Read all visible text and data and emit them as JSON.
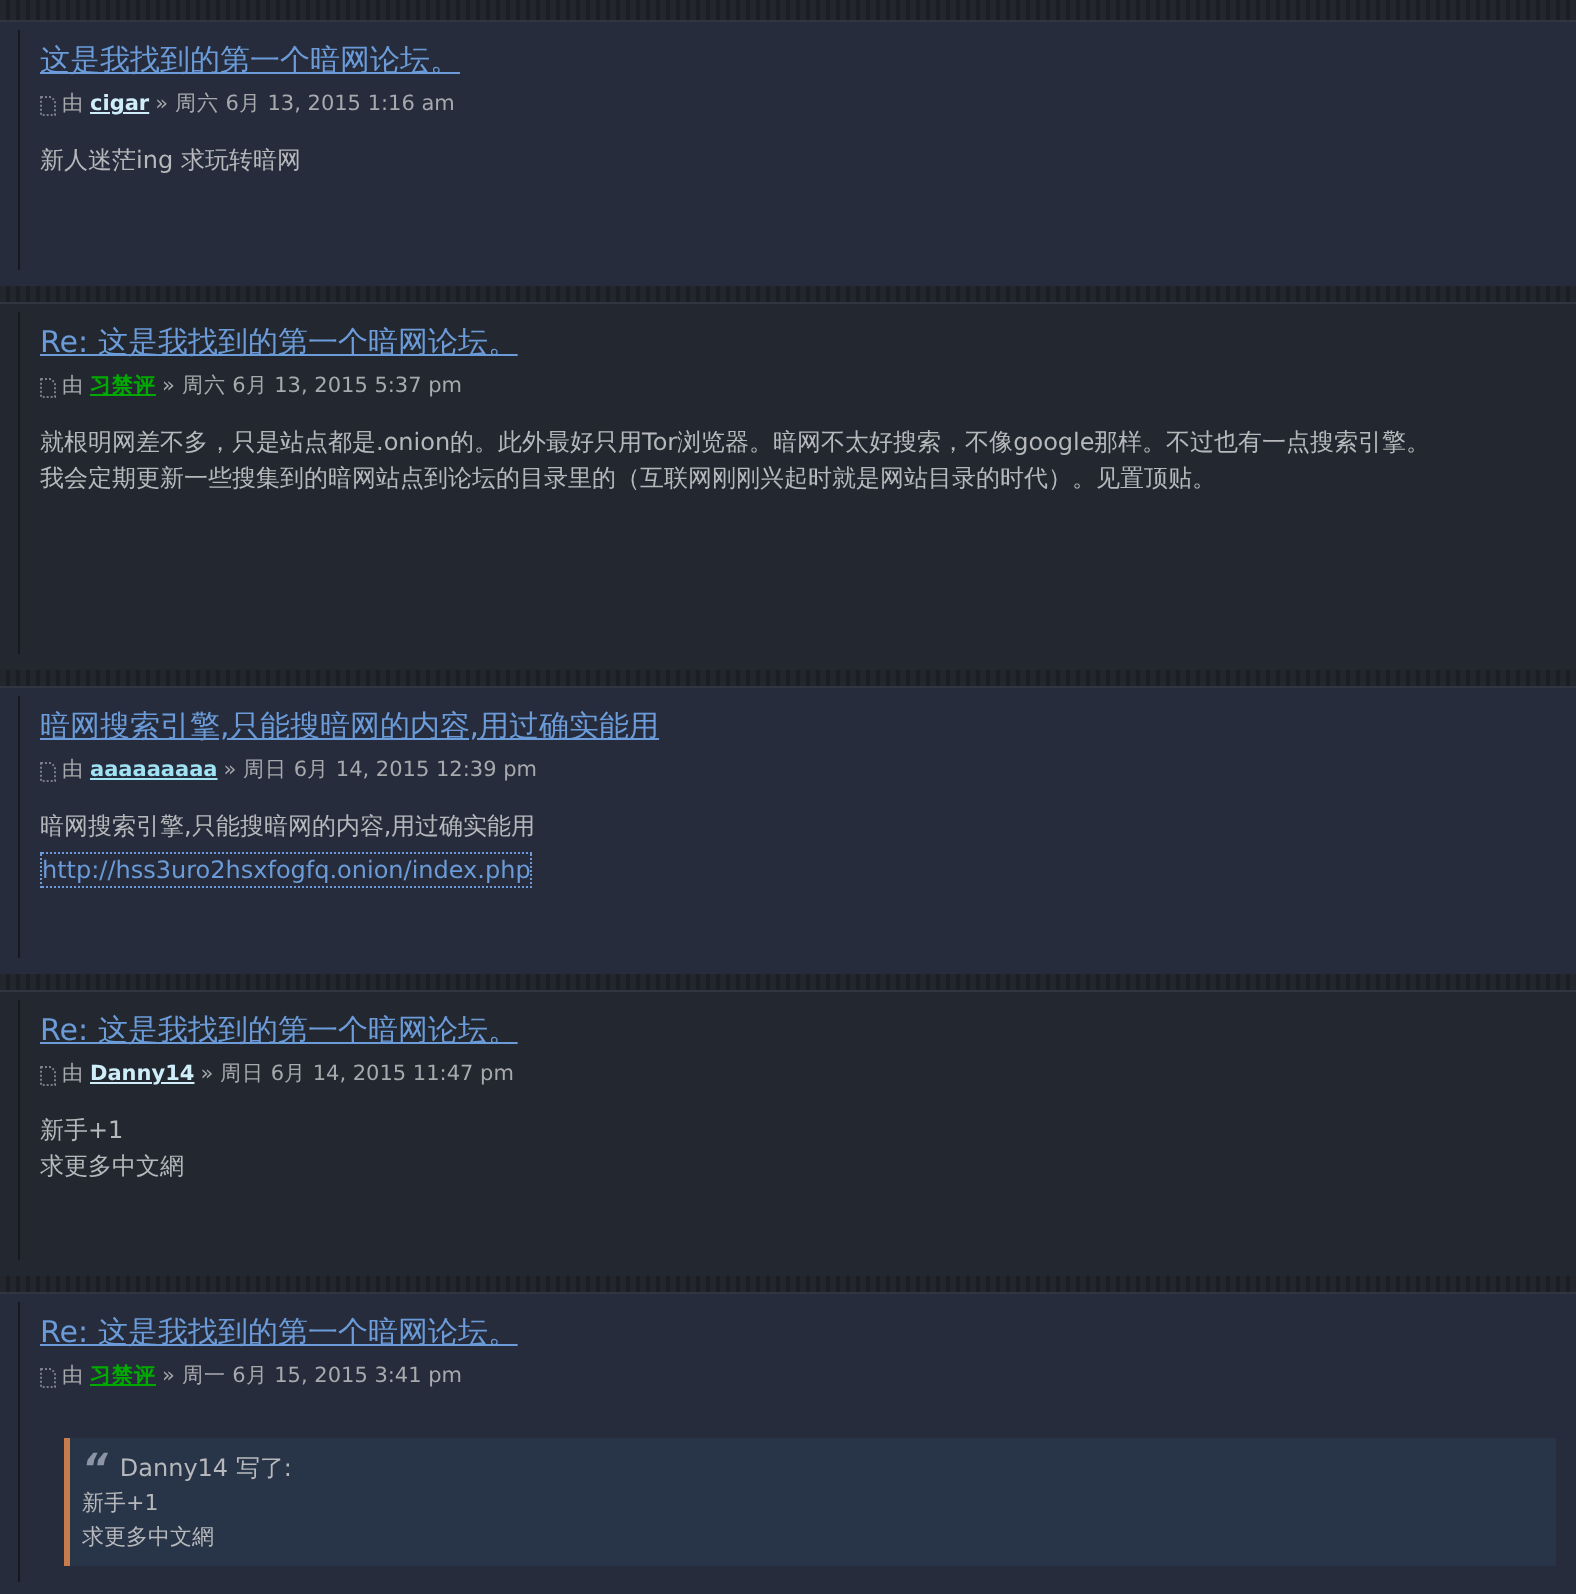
{
  "posts": [
    {
      "title": "这是我找到的第一个暗网论坛。",
      "by": "由",
      "author": "cigar",
      "color": "#cfeefa",
      "date": "» 周六 6月 13, 2015 1:16 am",
      "body": [
        {
          "kind": "text",
          "text": "新人迷茫ing 求玩转暗网"
        }
      ]
    },
    {
      "title": "Re: 这是我找到的第一个暗网论坛。",
      "by": "由",
      "author": "习禁评",
      "color": "#00aa00",
      "date": "» 周六 6月 13, 2015 5:37 pm",
      "body": [
        {
          "kind": "text",
          "text": "就根明网差不多，只是站点都是.onion的。此外最好只用Tor浏览器。暗网不太好搜索，不像google那样。不过也有一点搜索引擎。"
        },
        {
          "kind": "text",
          "text": "我会定期更新一些搜集到的暗网站点到论坛的目录里的（互联网刚刚兴起时就是网站目录的时代）。见置顶贴。"
        }
      ]
    },
    {
      "title": "暗网搜索引擎,只能搜暗网的内容,用过确实能用",
      "by": "由",
      "author": "aaaaaaaaa",
      "color": "#9fe3f5",
      "date": "» 周日 6月 14, 2015 12:39 pm",
      "body": [
        {
          "kind": "text",
          "text": "暗网搜索引擎,只能搜暗网的内容,用过确实能用"
        },
        {
          "kind": "link",
          "text": "http://hss3uro2hsxfogfq.onion/index.php"
        }
      ]
    },
    {
      "title": "Re: 这是我找到的第一个暗网论坛。",
      "by": "由",
      "author": "Danny14",
      "color": "#cfeefa",
      "date": "» 周日 6月 14, 2015 11:47 pm",
      "body": [
        {
          "kind": "text",
          "text": "新手+1"
        },
        {
          "kind": "text",
          "text": "求更多中文網"
        }
      ]
    },
    {
      "title": "Re: 这是我找到的第一个暗网论坛。",
      "by": "由",
      "author": "习禁评",
      "color": "#00aa00",
      "date": "» 周一 6月 15, 2015 3:41 pm",
      "body": [
        {
          "kind": "quote",
          "mark": "“",
          "cite": "Danny14 写了:",
          "lines": [
            "新手+1",
            "求更多中文網"
          ]
        }
      ]
    }
  ]
}
